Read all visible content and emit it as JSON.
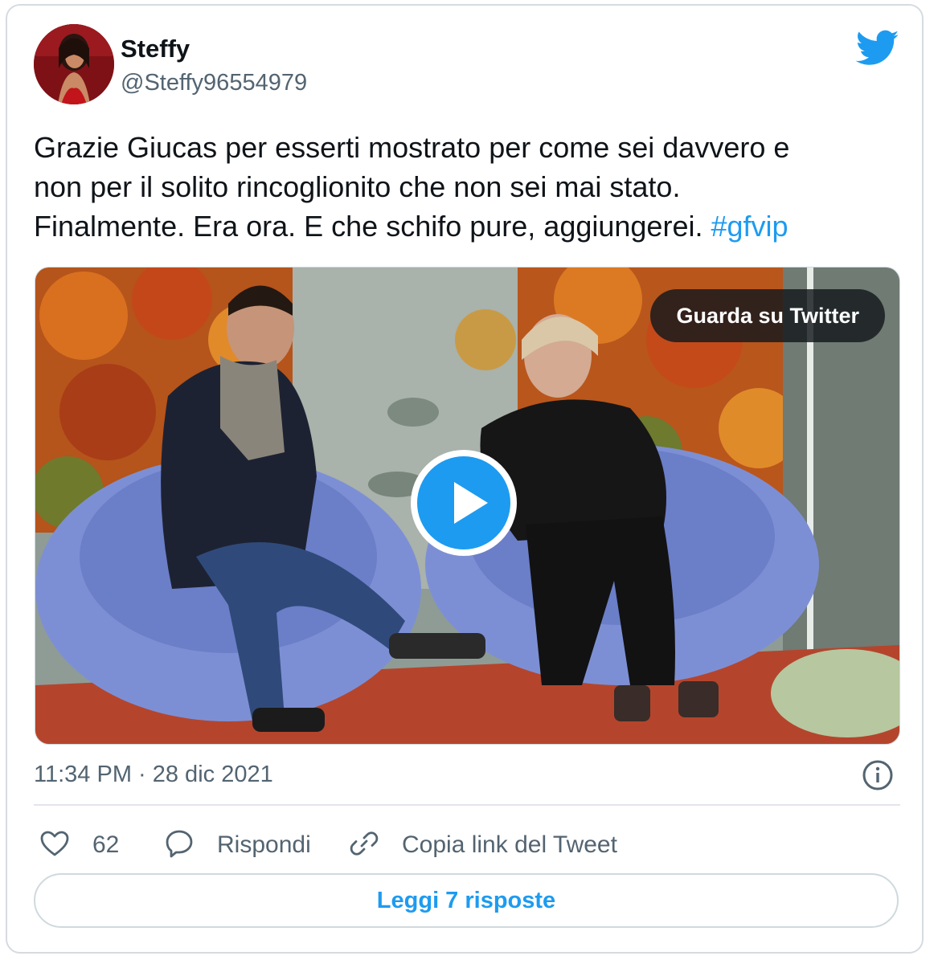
{
  "author": {
    "name": "Steffy",
    "handle": "@Steffy96554979"
  },
  "tweet": {
    "text": "Grazie Giucas per esserti mostrato per come sei davvero e\nnon per il solito rincoglionito che non sei mai stato.\nFinalmente. Era ora. E che schifo pure, aggiungerei. ",
    "hashtag": "#gfvip"
  },
  "media": {
    "watch_label": "Guarda su Twitter"
  },
  "meta": {
    "timestamp": "11:34 PM · 28 dic 2021"
  },
  "actions": {
    "likes": "62",
    "reply_label": "Rispondi",
    "copy_label": "Copia link del Tweet"
  },
  "read_replies_label": "Leggi 7 risposte",
  "colors": {
    "accent": "#1d9bf0",
    "secondary_text": "#536471",
    "border": "#cfd9de"
  },
  "icons": [
    "twitter-bird-icon",
    "play-icon",
    "info-icon",
    "heart-icon",
    "reply-icon",
    "link-icon"
  ]
}
